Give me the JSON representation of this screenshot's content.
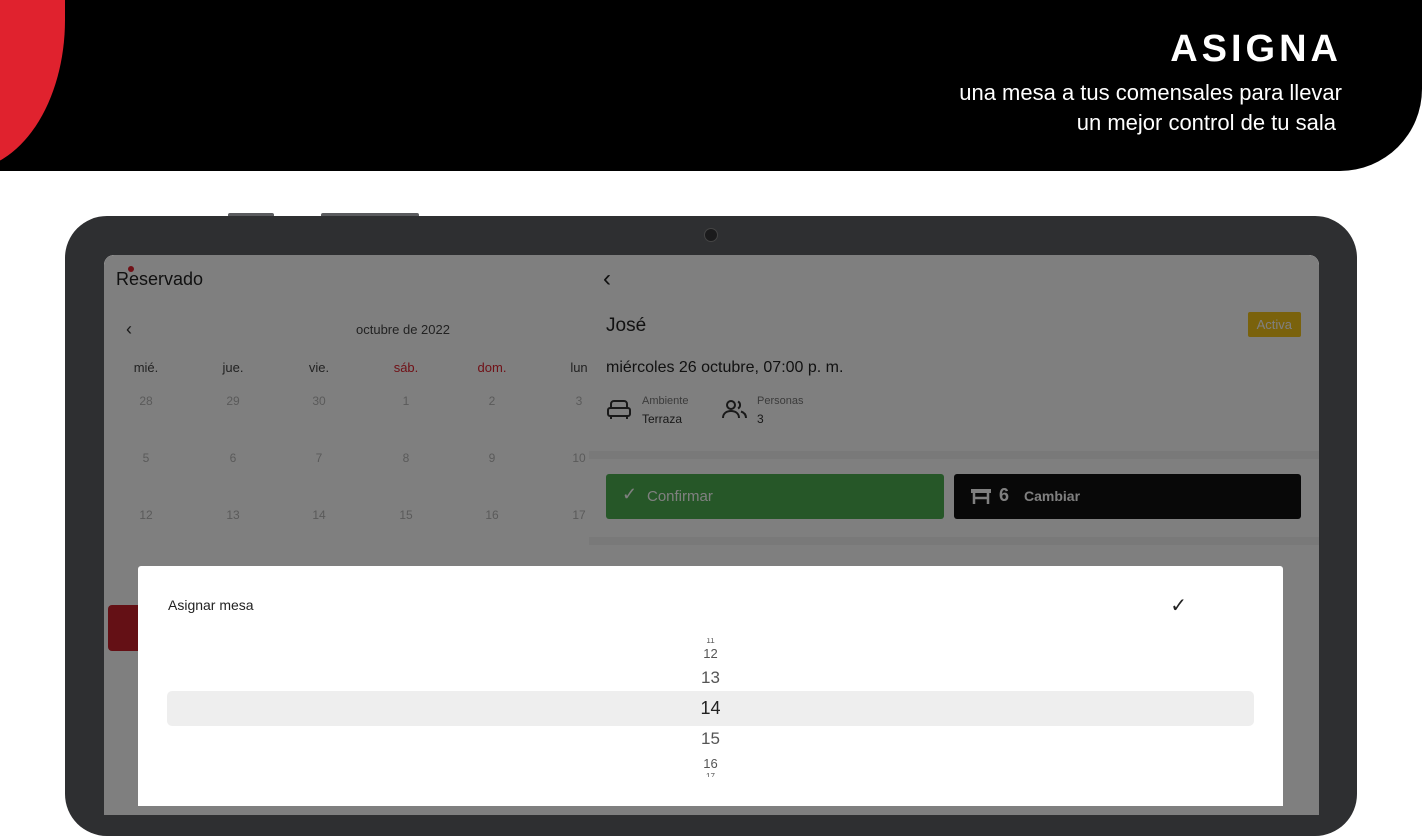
{
  "banner": {
    "headline": "ASIGNA",
    "tagline_line1": "una mesa a tus comensales para llevar",
    "tagline_line2": "un mejor control de tu sala"
  },
  "colors": {
    "brand_red": "#e0222e",
    "confirm_green": "#4caf50",
    "badge_yellow": "#f5c518"
  },
  "app": {
    "logo": "Reservado",
    "calendar": {
      "month_label": "octubre de 2022",
      "weekdays": [
        "mié.",
        "jue.",
        "vie.",
        "sáb.",
        "dom.",
        "lun"
      ],
      "rows": [
        [
          "28",
          "29",
          "30",
          "1",
          "2",
          "3"
        ],
        [
          "5",
          "6",
          "7",
          "8",
          "9",
          "10"
        ],
        [
          "12",
          "13",
          "14",
          "15",
          "16",
          "17"
        ]
      ]
    },
    "reservation": {
      "guest_name": "José",
      "status": "Activa",
      "datetime": "miércoles 26 octubre, 07:00 p. m.",
      "ambiente_label": "Ambiente",
      "ambiente_value": "Terraza",
      "personas_label": "Personas",
      "personas_value": "3",
      "confirm_label": "Confirmar",
      "table_number": "6",
      "change_label": "Cambiar"
    },
    "dialog": {
      "title": "Asignar mesa",
      "options": [
        "11",
        "12",
        "13",
        "14",
        "15",
        "16",
        "17"
      ],
      "selected": "14"
    }
  }
}
